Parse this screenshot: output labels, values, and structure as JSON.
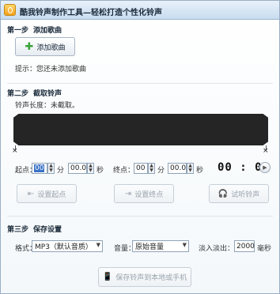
{
  "window": {
    "title": "酷我铃声制作工具—轻松打造个性化铃声"
  },
  "step1": {
    "label": "第一步",
    "title": "添加歌曲",
    "add_button": "添加歌曲",
    "hint": "提示：您还未添加歌曲"
  },
  "step2": {
    "label": "第二步",
    "title": "截取铃声",
    "duration": "铃声长度：未截取。",
    "start_label": "起点：",
    "start_min": "00",
    "min_unit": "分",
    "start_sec": "00.0",
    "sec_unit": "秒",
    "end_label": "终点：",
    "end_min": "00",
    "end_sec": "00.0",
    "time_display": "00 : 00",
    "set_start_button": "设置起点",
    "set_end_button": "设置终点",
    "preview_button": "试听铃声",
    "marker_glyph": "×"
  },
  "step3": {
    "label": "第三步",
    "title": "保存设置",
    "format_label": "格式：",
    "format_value": "MP3（默认音质）",
    "volume_label": "音量：",
    "volume_value": "原始音量",
    "fade_label": "淡入淡出：",
    "fade_value": "2000",
    "fade_unit": "毫秒",
    "save_button": "保存铃声到本地或手机"
  },
  "icons": {
    "plus_color": "#3aa23a",
    "accent": "#3a73c8"
  }
}
